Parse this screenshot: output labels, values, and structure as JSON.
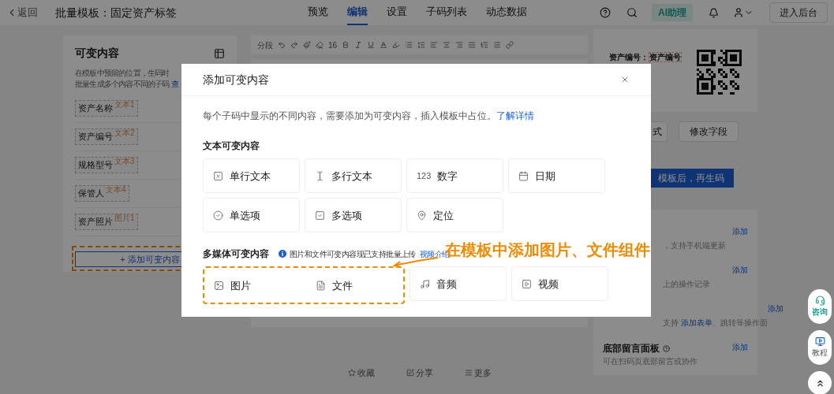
{
  "header": {
    "back": "返回",
    "title": "批量模板：固定资产标签",
    "tabs": [
      {
        "label": "预览",
        "selected": false
      },
      {
        "label": "编辑",
        "selected": true
      },
      {
        "label": "设置",
        "selected": false
      },
      {
        "label": "子码列表",
        "selected": false
      },
      {
        "label": "动态数据",
        "selected": false
      }
    ],
    "ai_badge": "AI助理",
    "console_button": "进入后台"
  },
  "variables_panel": {
    "title": "可变内容",
    "description": [
      "在模板中预留的位置，生码时",
      "批量生成多个内容不同的子码"
    ],
    "more_link": "查",
    "items": [
      {
        "label": "资产名称",
        "tag": "文本1"
      },
      {
        "label": "资产编号",
        "tag": "文本2"
      },
      {
        "label": "规格型号",
        "tag": "文本3"
      },
      {
        "label": "保管人",
        "tag": "文本4"
      },
      {
        "label": "资产照片",
        "tag": "图片1"
      }
    ],
    "add_button": {
      "label": "+ 添加可变内容",
      "highlighted": true
    }
  },
  "editor": {
    "paragraph": "分段",
    "font_size": "16",
    "footer": [
      {
        "kind": "star",
        "label": "收藏"
      },
      {
        "kind": "share",
        "label": "分享"
      },
      {
        "kind": "more",
        "label": "更多"
      }
    ]
  },
  "preview": {
    "field_label": "资产编号：",
    "field_value": "资产编号",
    "buttons": [
      "式",
      "修改字段"
    ],
    "generate_button": "模板后，再生码"
  },
  "components_panel": {
    "items": [
      {
        "description": "，支持手机端更新",
        "action": "添加"
      },
      {
        "description": "上的操作记录",
        "action": "添加"
      },
      {
        "description": "支持 ",
        "link": "添加表单",
        "description_end": "、跳转等操作面",
        "action": "添加"
      },
      {
        "title": "底部留言面板",
        "description": "可在扫码页底部留言或协作",
        "action": "添加"
      }
    ]
  },
  "floating": [
    {
      "kind": "consult",
      "label": "咨询"
    },
    {
      "kind": "tutorial",
      "label": "教程"
    },
    {
      "kind": "top"
    }
  ],
  "dialog": {
    "title": "添加可变内容",
    "description": "每个子码中显示的不同内容，需要添加为可变内容，插入模板中占位。",
    "link": "了解详情",
    "sections": [
      {
        "title": "文本可变内容",
        "options": [
          {
            "kind": "single_line",
            "label": "单行文本",
            "highlighted": false
          },
          {
            "kind": "multi_line",
            "label": "多行文本",
            "highlighted": false
          },
          {
            "kind": "number",
            "icon_text": "123",
            "label": "数字",
            "highlighted": false
          },
          {
            "kind": "date",
            "label": "日期",
            "highlighted": false
          },
          {
            "kind": "radio",
            "label": "单选项",
            "highlighted": false
          },
          {
            "kind": "checkbox",
            "label": "多选项",
            "highlighted": false
          },
          {
            "kind": "location",
            "label": "定位",
            "highlighted": false
          }
        ]
      },
      {
        "title": "多媒体可变内容",
        "note": "图片和文件可变内容现已支持批量上传",
        "note_link": "视频介绍",
        "options": [
          {
            "kind": "image",
            "label": "图片",
            "highlighted": true
          },
          {
            "kind": "file",
            "label": "文件",
            "highlighted": true
          },
          {
            "kind": "audio",
            "label": "音频",
            "highlighted": false
          },
          {
            "kind": "video",
            "label": "视频",
            "highlighted": false
          }
        ]
      }
    ]
  },
  "annotation": {
    "text": "在模板中添加图片、文件组件"
  }
}
